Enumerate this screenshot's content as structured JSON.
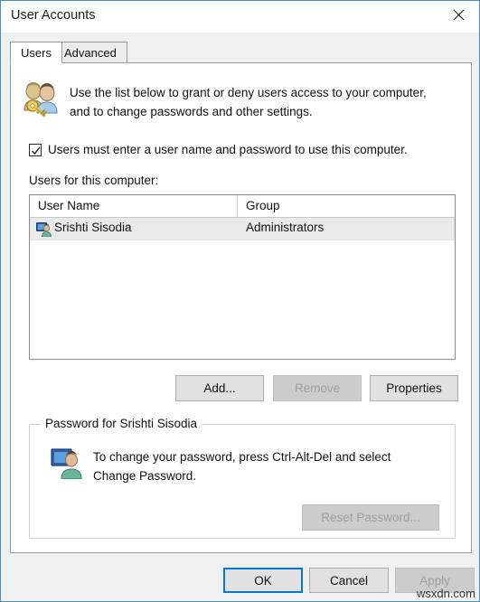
{
  "window": {
    "title": "User Accounts",
    "close_icon": "close-icon"
  },
  "tabs": [
    {
      "label": "Users",
      "active": true
    },
    {
      "label": "Advanced",
      "active": false
    }
  ],
  "panel": {
    "header_icon": "users-key-icon",
    "header_text": "Use the list below to grant or deny users access to your computer, and to change passwords and other settings.",
    "checkbox": {
      "label": "Users must enter a user name and password to use this computer.",
      "checked": true
    },
    "list_caption": "Users for this computer:",
    "list": {
      "columns": [
        "User Name",
        "Group"
      ],
      "rows": [
        {
          "icon": "user-monitor-icon",
          "user_name": "Srishti Sisodia",
          "group": "Administrators",
          "selected": true
        }
      ]
    },
    "list_buttons": [
      {
        "label": "Add...",
        "enabled": true
      },
      {
        "label": "Remove",
        "enabled": false
      },
      {
        "label": "Properties",
        "enabled": true
      }
    ],
    "password_group": {
      "legend": "Password for Srishti Sisodia",
      "icon": "user-monitor-icon",
      "text": "To change your password, press Ctrl-Alt-Del and select Change Password.",
      "button": {
        "label": "Reset Password...",
        "enabled": false
      }
    }
  },
  "footer": {
    "buttons": [
      {
        "label": "OK",
        "enabled": true,
        "focused": true
      },
      {
        "label": "Cancel",
        "enabled": true,
        "focused": false
      },
      {
        "label": "Apply",
        "enabled": false,
        "focused": false
      }
    ]
  },
  "watermark": "wsxdn.com",
  "colors": {
    "window_border": "#4b8dc0",
    "accent_focus": "#0078d7",
    "panel_bg": "#ffffff",
    "footer_bg": "#f0f0f0",
    "selected_row": "#eaeaea",
    "disabled_fill": "#cccccc"
  }
}
